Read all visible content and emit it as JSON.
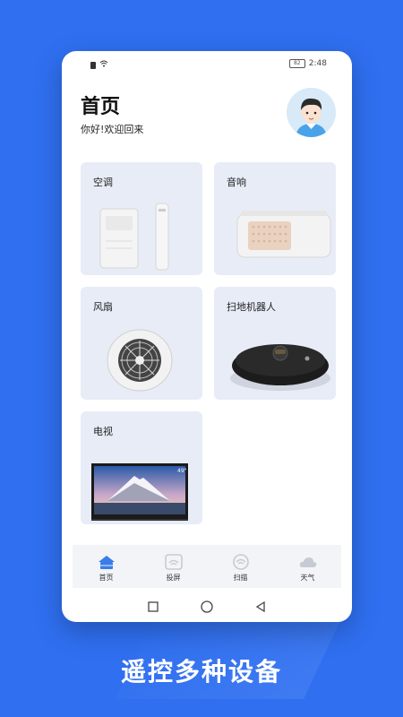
{
  "status_bar": {
    "time": "2:48",
    "battery": "82"
  },
  "header": {
    "title": "首页",
    "greeting": "你好!欢迎回来"
  },
  "devices": [
    {
      "label": "空调"
    },
    {
      "label": "音响"
    },
    {
      "label": "风扇"
    },
    {
      "label": "扫地机器人"
    },
    {
      "label": "电视"
    }
  ],
  "tv_screen_text": "49\"",
  "tabs": [
    {
      "label": "首页",
      "active": true
    },
    {
      "label": "投屏"
    },
    {
      "label": "扫描"
    },
    {
      "label": "天气"
    }
  ],
  "banner": "遥控多种设备",
  "colors": {
    "accent": "#3a7de8",
    "card": "#e7ecf7",
    "background": "#2f6ff0"
  }
}
